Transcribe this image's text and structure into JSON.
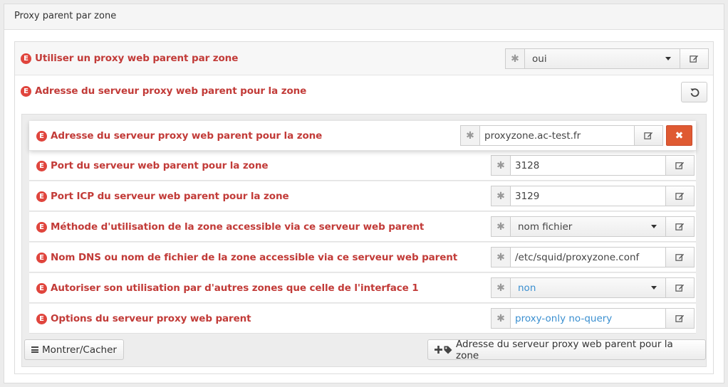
{
  "panel": {
    "title": "Proxy parent par zone"
  },
  "badge_letter": "E",
  "outer_fields": [
    {
      "label": "Utiliser un proxy web parent par zone",
      "value": "oui",
      "type": "select"
    },
    {
      "label": "Adresse du serveur proxy web parent pour la zone"
    }
  ],
  "inner_fields": [
    {
      "label": "Adresse du serveur proxy web parent pour la zone",
      "value": "proxyzone.ac-test.fr",
      "type": "text"
    },
    {
      "label": "Port du serveur web parent pour la zone",
      "value": "3128",
      "type": "text"
    },
    {
      "label": "Port ICP du serveur web parent pour la zone",
      "value": "3129",
      "type": "text"
    },
    {
      "label": "Méthode d'utilisation de la zone accessible via ce serveur web parent",
      "value": "nom fichier",
      "type": "select"
    },
    {
      "label": "Nom DNS ou nom de fichier de la zone accessible via ce serveur web parent",
      "value": "/etc/squid/proxyzone.conf",
      "type": "text"
    },
    {
      "label": "Autoriser son utilisation par d'autres zones que celle de l'interface 1",
      "value": "non",
      "type": "select"
    },
    {
      "label": "Options du serveur proxy web parent",
      "value": "proxy-only no-query",
      "type": "text"
    }
  ],
  "footer": {
    "toggle_label": "Montrer/Cacher",
    "add_label": "Adresse du serveur proxy web parent pour la zone"
  },
  "symbols": {
    "asterisk": "✱",
    "delete": "✖"
  },
  "colors": {
    "label_red": "#c23b38",
    "badge_red": "#e0453d",
    "delete_orange": "#df5a32",
    "default_blue": "#3a8fd0"
  }
}
